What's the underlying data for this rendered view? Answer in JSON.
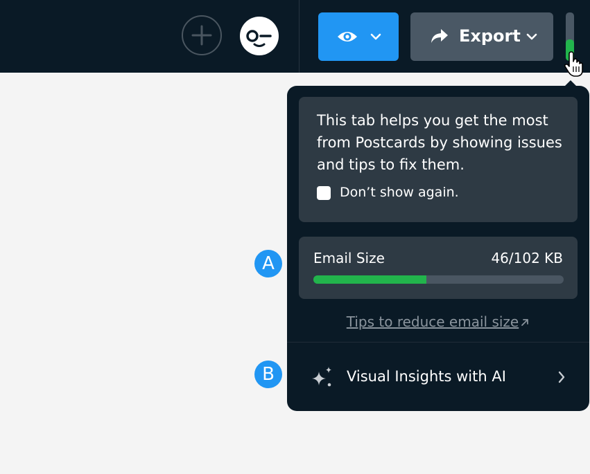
{
  "topbar": {
    "export_label": "Export",
    "icons": {
      "add": "plus-circle-icon",
      "avatar": "user-avatar-icon",
      "preview": "eye-icon",
      "preview_dropdown": "chevron-down-icon",
      "export": "share-arrow-icon",
      "export_dropdown": "chevron-down-icon"
    },
    "health_indicator_level": 0.45
  },
  "colors": {
    "topbar_bg": "#0a1a26",
    "preview_button": "#2196f3",
    "export_button": "#4a5865",
    "card_bg": "#2e3a44",
    "progress_fill": "#22b44c",
    "badge": "#2196f3"
  },
  "popover": {
    "info_text": "This tab helps you get the most from Postcards by showing issues and tips to fix them.",
    "dont_show_label": "Don’t show again.",
    "dont_show_checked": false,
    "email_size": {
      "label": "Email Size",
      "value_text": "46/102 KB",
      "used_kb": 46,
      "limit_kb": 102
    },
    "tips_link": "Tips to reduce email size",
    "tips_link_icon": "external-link-arrow-icon",
    "ai_row": {
      "label": "Visual Insights with AI",
      "icon": "sparkles-icon",
      "chevron": "chevron-right-icon"
    }
  },
  "annotations": {
    "a": "A",
    "b": "B"
  }
}
